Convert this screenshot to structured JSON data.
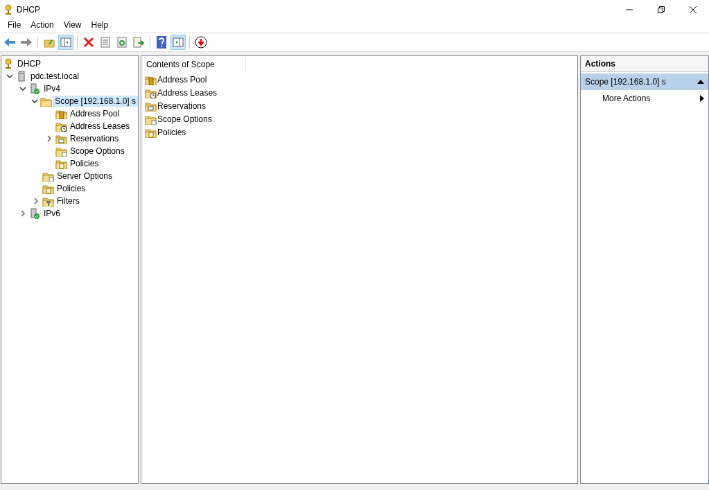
{
  "window": {
    "title": "DHCP"
  },
  "menu": [
    {
      "label": "File"
    },
    {
      "label": "Action"
    },
    {
      "label": "View"
    },
    {
      "label": "Help"
    }
  ],
  "toolbar": [
    {
      "kind": "back",
      "pressed": false
    },
    {
      "kind": "forward",
      "pressed": false
    },
    {
      "kind": "separator"
    },
    {
      "kind": "up",
      "pressed": false
    },
    {
      "kind": "tree",
      "pressed": true
    },
    {
      "kind": "separator"
    },
    {
      "kind": "delete",
      "pressed": false
    },
    {
      "kind": "properties",
      "pressed": false
    },
    {
      "kind": "refresh",
      "pressed": false
    },
    {
      "kind": "export",
      "pressed": false
    },
    {
      "kind": "separator"
    },
    {
      "kind": "help",
      "pressed": false
    },
    {
      "kind": "actionpane",
      "pressed": true
    },
    {
      "kind": "separator"
    },
    {
      "kind": "stop",
      "pressed": false
    }
  ],
  "tree": [
    {
      "label": "DHCP",
      "kind": "dhcp",
      "selected": false,
      "children": [
        {
          "label": "pdc.test.local",
          "kind": "server",
          "expanded": true,
          "selected": false,
          "children": [
            {
              "label": "IPv4",
              "kind": "ipv",
              "expanded": true,
              "selected": false,
              "children": [
                {
                  "label": "Scope [192.168.1.0] s",
                  "kind": "scope",
                  "expanded": true,
                  "selected": true,
                  "children": [
                    {
                      "label": "Address Pool",
                      "kind": "pool",
                      "selected": false
                    },
                    {
                      "label": "Address Leases",
                      "kind": "leases",
                      "selected": false
                    },
                    {
                      "label": "Reservations",
                      "kind": "reservations",
                      "expanded": false,
                      "selected": false
                    },
                    {
                      "label": "Scope Options",
                      "kind": "options",
                      "selected": false
                    },
                    {
                      "label": "Policies",
                      "kind": "policies",
                      "selected": false
                    }
                  ]
                },
                {
                  "label": "Server Options",
                  "kind": "options",
                  "selected": false
                },
                {
                  "label": "Policies",
                  "kind": "policies",
                  "selected": false
                },
                {
                  "label": "Filters",
                  "kind": "filters",
                  "expanded": false,
                  "selected": false
                }
              ]
            },
            {
              "label": "IPv6",
              "kind": "ipv",
              "expanded": false,
              "selected": false
            }
          ]
        }
      ]
    }
  ],
  "content": {
    "column_header": "Contents of Scope",
    "items": [
      {
        "label": "Address Pool",
        "kind": "pool"
      },
      {
        "label": "Address Leases",
        "kind": "leases"
      },
      {
        "label": "Reservations",
        "kind": "reservations"
      },
      {
        "label": "Scope Options",
        "kind": "options"
      },
      {
        "label": "Policies",
        "kind": "policies"
      }
    ]
  },
  "actions": {
    "title": "Actions",
    "groups": [
      {
        "label": "Scope [192.168.1.0] s",
        "expanded": true,
        "items": [
          {
            "label": "More Actions",
            "submenu": true
          }
        ]
      }
    ]
  }
}
